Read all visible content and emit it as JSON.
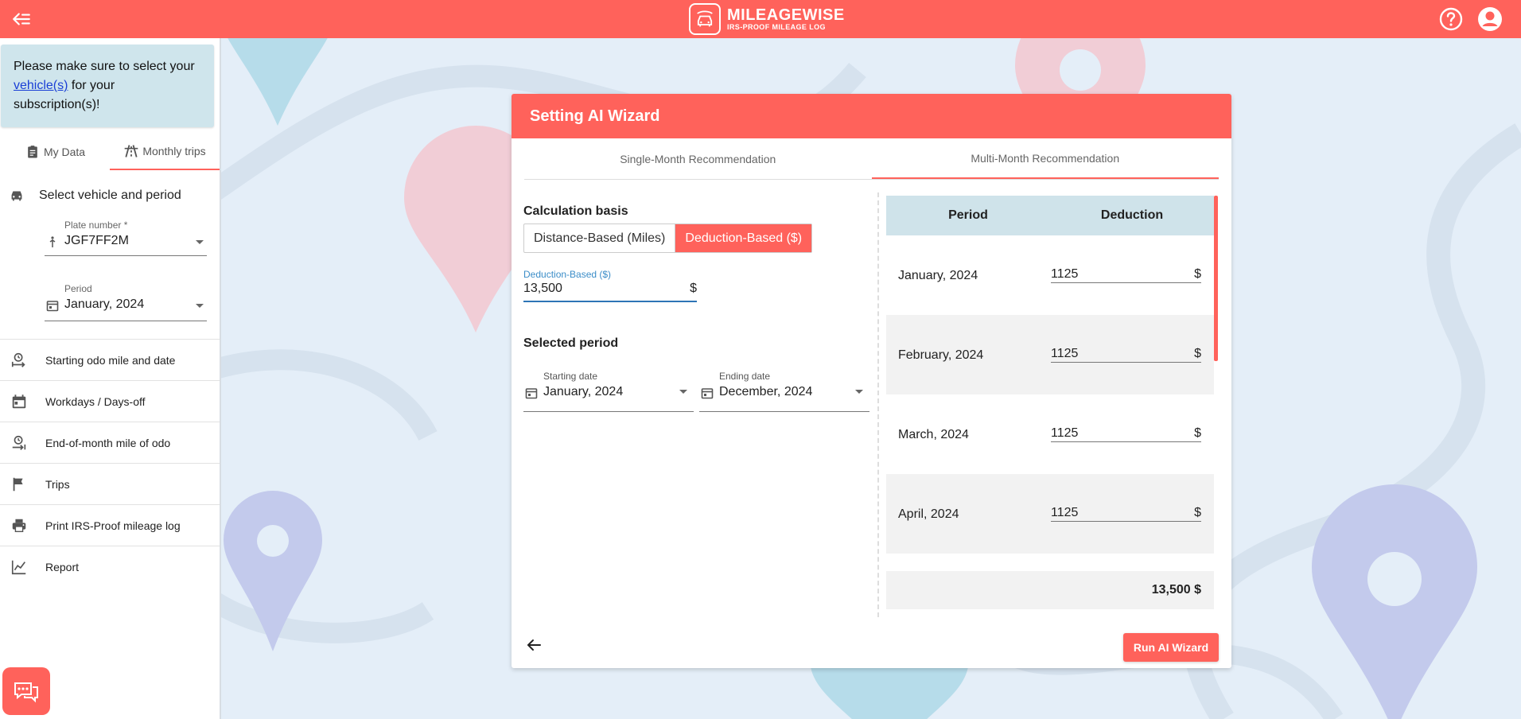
{
  "header": {
    "brand_name": "MILEAGEWISE",
    "brand_tagline": "IRS-PROOF MILEAGE LOG",
    "icons": [
      "back-arrow-icon",
      "help-icon",
      "account-icon"
    ]
  },
  "colors": {
    "accent": "#ff625b",
    "info_bg": "#cfe5ec",
    "page_bg": "#e4eef8"
  },
  "sidebar": {
    "notice_pre": "Please make sure to select your ",
    "notice_link": "vehicle(s)",
    "notice_post": " for your subscription(s)!",
    "tabs": [
      {
        "label": "My Data",
        "icon": "clipboard-icon",
        "active": false
      },
      {
        "label": "Monthly trips",
        "icon": "road-icon",
        "active": true
      }
    ],
    "section_title": "Select vehicle and period",
    "plate_label": "Plate number *",
    "plate_value": "JGF7FF2M",
    "period_label": "Period",
    "period_value": "January, 2024",
    "items": [
      {
        "label": "Starting odo mile and date",
        "icon": "odometer-start-icon"
      },
      {
        "label": "Workdays / Days-off",
        "icon": "calendar-icon"
      },
      {
        "label": "End-of-month mile of odo",
        "icon": "odometer-end-icon"
      },
      {
        "label": "Trips",
        "icon": "flag-icon"
      },
      {
        "label": "Print IRS-Proof mileage log",
        "icon": "printer-icon"
      },
      {
        "label": "Report",
        "icon": "chart-icon"
      }
    ]
  },
  "modal": {
    "title": "Setting AI Wizard",
    "tabs": [
      {
        "label": "Single-Month Recommendation",
        "active": false
      },
      {
        "label": "Multi-Month Recommendation",
        "active": true
      }
    ],
    "calc_basis_title": "Calculation basis",
    "toggle_options": [
      {
        "label": "Distance-Based (Miles)",
        "selected": false
      },
      {
        "label": "Deduction-Based ($)",
        "selected": true
      }
    ],
    "deduction_field": {
      "label": "Deduction-Based ($)",
      "value": "13,500",
      "unit": "$"
    },
    "selected_period_title": "Selected period",
    "start_date": {
      "label": "Starting date",
      "value": "January, 2024"
    },
    "end_date": {
      "label": "Ending date",
      "value": "December, 2024"
    },
    "table": {
      "headers": [
        "Period",
        "Deduction"
      ],
      "rows": [
        {
          "period": "January, 2024",
          "deduction": "1125",
          "unit": "$"
        },
        {
          "period": "February, 2024",
          "deduction": "1125",
          "unit": "$"
        },
        {
          "period": "March, 2024",
          "deduction": "1125",
          "unit": "$"
        },
        {
          "period": "April, 2024",
          "deduction": "1125",
          "unit": "$"
        }
      ],
      "total": "13,500 $"
    },
    "run_button": "Run AI Wizard"
  }
}
